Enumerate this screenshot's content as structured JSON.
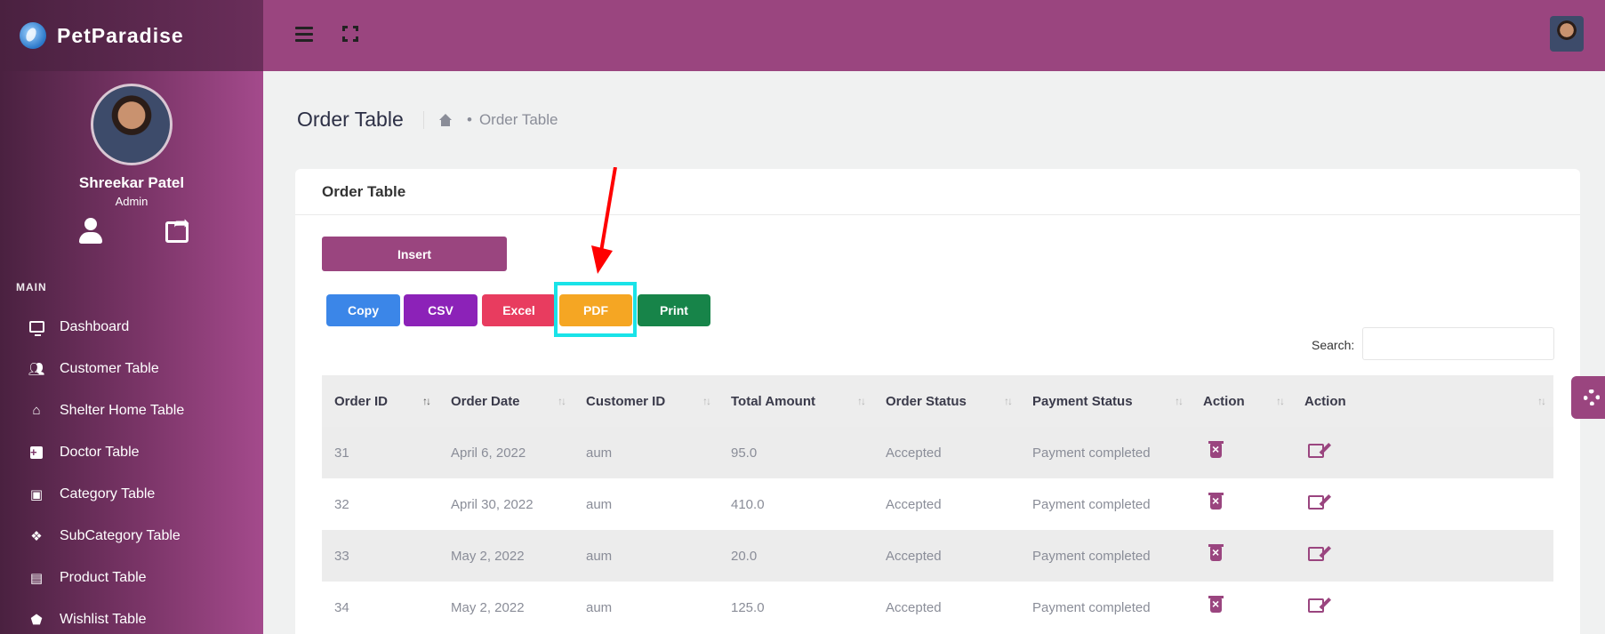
{
  "brand": {
    "name": "PetParadise"
  },
  "profile": {
    "name": "Shreekar Patel",
    "role": "Admin"
  },
  "sidebar": {
    "section_label": "MAIN",
    "items": [
      {
        "label": "Dashboard",
        "icon": "monitor-icon"
      },
      {
        "label": "Customer Table",
        "icon": "users-icon"
      },
      {
        "label": "Shelter Home Table",
        "icon": "home-icon"
      },
      {
        "label": "Doctor Table",
        "icon": "plus-square-icon"
      },
      {
        "label": "Category Table",
        "icon": "cube-icon"
      },
      {
        "label": "SubCategory Table",
        "icon": "cubes-icon"
      },
      {
        "label": "Product Table",
        "icon": "archive-icon"
      },
      {
        "label": "Wishlist Table",
        "icon": "tags-icon"
      }
    ]
  },
  "page": {
    "title": "Order Table",
    "breadcrumb": "Order Table"
  },
  "card": {
    "title": "Order Table",
    "insert_label": "Insert",
    "export_buttons": [
      "Copy",
      "CSV",
      "Excel",
      "PDF",
      "Print"
    ],
    "search_label": "Search:",
    "search_value": ""
  },
  "table": {
    "headers": [
      "Order ID",
      "Order Date",
      "Customer ID",
      "Total Amount",
      "Order Status",
      "Payment Status",
      "Action",
      "Action"
    ],
    "rows": [
      [
        "31",
        "April 6, 2022",
        "aum",
        "95.0",
        "Accepted",
        "Payment completed"
      ],
      [
        "32",
        "April 30, 2022",
        "aum",
        "410.0",
        "Accepted",
        "Payment completed"
      ],
      [
        "33",
        "May 2, 2022",
        "aum",
        "20.0",
        "Accepted",
        "Payment completed"
      ],
      [
        "34",
        "May 2, 2022",
        "aum",
        "125.0",
        "Accepted",
        "Payment completed"
      ]
    ]
  },
  "colors": {
    "primary": "#9a457f",
    "highlight": "#19e3e8",
    "arrow": "#ff0000"
  }
}
